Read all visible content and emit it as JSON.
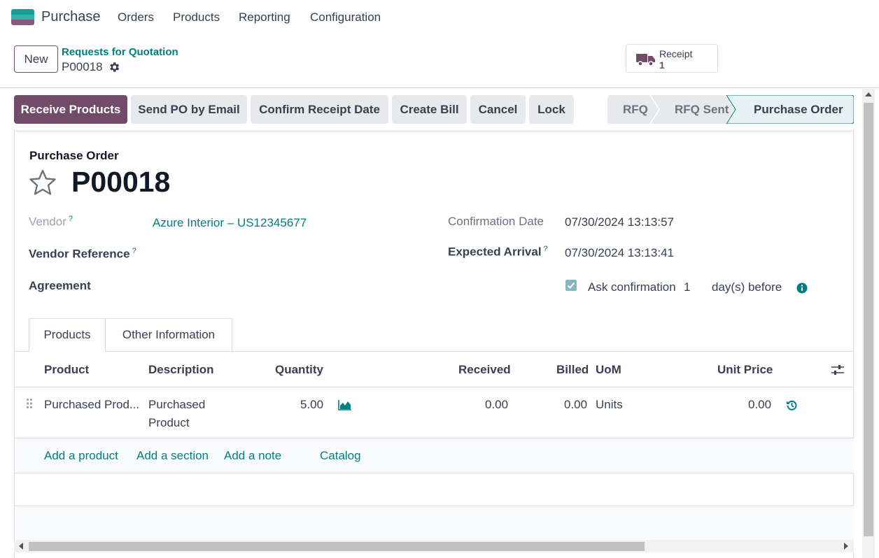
{
  "navbar": {
    "app_name": "Purchase",
    "menu": [
      "Orders",
      "Products",
      "Reporting",
      "Configuration"
    ]
  },
  "control": {
    "new_label": "New",
    "breadcrumb": "Requests for Quotation",
    "record": "P00018",
    "smart_button": {
      "label": "Receipt",
      "count": "1"
    }
  },
  "actions": {
    "receive": "Receive Products",
    "send_email": "Send PO by Email",
    "confirm_receipt": "Confirm Receipt Date",
    "create_bill": "Create Bill",
    "cancel": "Cancel",
    "lock": "Lock"
  },
  "stages": [
    "RFQ",
    "RFQ Sent",
    "Purchase Order"
  ],
  "form": {
    "doc_label": "Purchase Order",
    "title": "P00018",
    "vendor_label": "Vendor",
    "vendor_value": "Azure Interior – US12345677",
    "vendor_ref_label": "Vendor Reference",
    "agreement_label": "Agreement",
    "confirmation_date_label": "Confirmation Date",
    "confirmation_date_value": "07/30/2024 13:13:57",
    "expected_arrival_label": "Expected Arrival",
    "expected_arrival_value": "07/30/2024 13:13:41",
    "ask_confirmation_label": "Ask confirmation",
    "ask_confirmation_days": "1",
    "days_before": "day(s) before",
    "help_mark": "?"
  },
  "tabs": [
    "Products",
    "Other Information"
  ],
  "table": {
    "headers": {
      "product": "Product",
      "description": "Description",
      "quantity": "Quantity",
      "received": "Received",
      "billed": "Billed",
      "uom": "UoM",
      "unit_price": "Unit Price"
    },
    "row": {
      "product": "Purchased Prod...",
      "description_1": "Purchased",
      "description_2": "Product",
      "quantity": "5.00",
      "received": "0.00",
      "billed": "0.00",
      "uom": "Units",
      "unit_price": "0.00"
    },
    "add_links": {
      "product": "Add a product",
      "section": "Add a section",
      "note": "Add a note",
      "catalog": "Catalog"
    }
  },
  "colors": {
    "primary": "#714B67",
    "link": "#017e84",
    "accent_teal": "#1a9e95"
  }
}
